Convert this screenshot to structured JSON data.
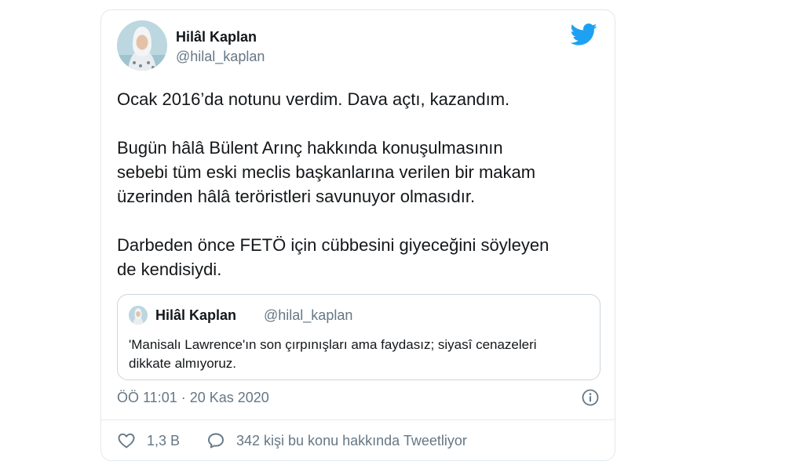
{
  "tweet": {
    "author": {
      "name": "Hilâl Kaplan",
      "handle": "@hilal_kaplan"
    },
    "text": {
      "p1": "Ocak 2016’da notunu verdim. Dava açtı, kazandım.",
      "p2_l1": "Bugün hâlâ Bülent Arınç hakkında konuşulmasının",
      "p2_l2": "sebebi tüm eski meclis başkanlarına verilen bir makam",
      "p2_l3": "üzerinden hâlâ teröristleri savunuyor olmasıdır.",
      "p3_l1": "Darbeden önce FETÖ için cübbesini giyeceğini söyleyen",
      "p3_l2": "de kendisiydi."
    },
    "quoted": {
      "name": "Hilâl Kaplan",
      "handle": "@hilal_kaplan",
      "text_l1": "'Manisalı Lawrence'ın son çırpınışları ama faydasız; siyasî cenazeleri",
      "text_l2": "dikkate almıyoruz."
    },
    "timestamp": "ÖÖ 11:01 · 20 Kas 2020",
    "likes": "1,3 B",
    "replies": "342 kişi bu konu hakkında Tweetliyor"
  },
  "colors": {
    "brand": "#1da1f2",
    "text": "#14171a",
    "secondary": "#657786",
    "border": "#e1e8ed"
  },
  "icons": {
    "logo": "twitter-bird-icon",
    "info": "info-icon",
    "like": "heart-icon",
    "reply": "speech-bubble-icon"
  }
}
